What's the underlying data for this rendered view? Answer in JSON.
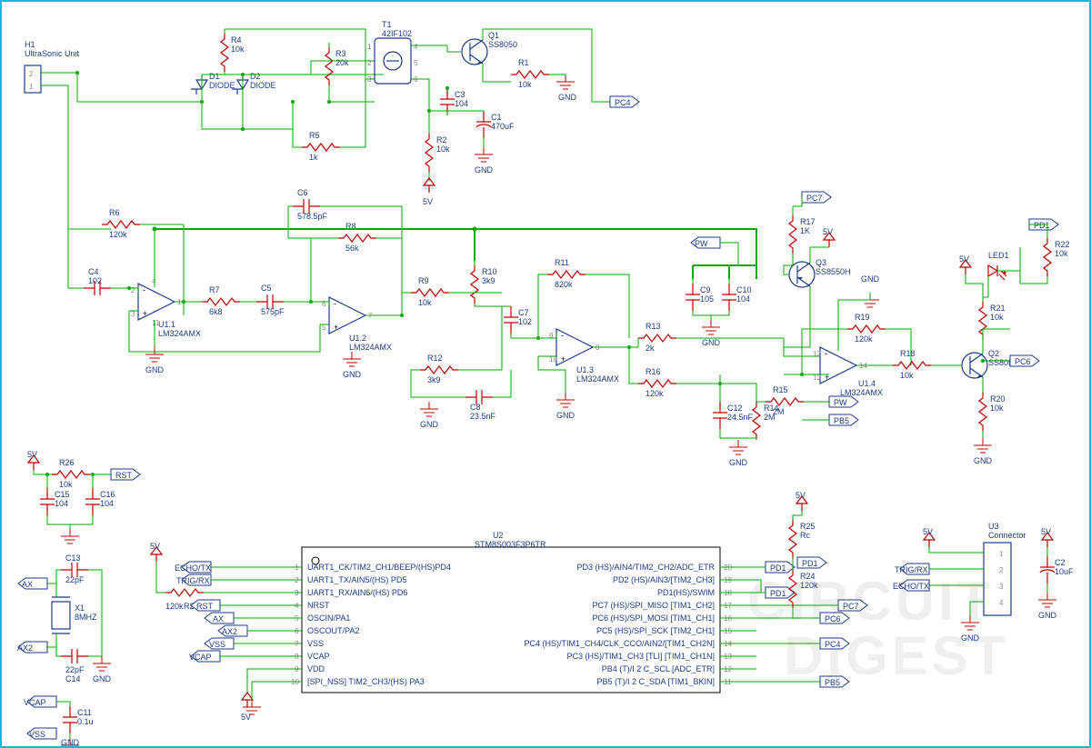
{
  "header": {
    "H1": {
      "ref": "H1",
      "name": "UltraSonic Unit"
    }
  },
  "transistors": {
    "Q1": {
      "ref": "Q1",
      "val": "SS8050"
    },
    "Q2": {
      "ref": "Q2",
      "val": "SS8050"
    },
    "Q3": {
      "ref": "Q3",
      "val": "SS8550H"
    }
  },
  "transformer": {
    "T1": {
      "ref": "T1",
      "val": "42IF102"
    }
  },
  "diodes": {
    "D1": {
      "ref": "D1",
      "val": "DIODE"
    },
    "D2": {
      "ref": "D2",
      "val": "DIODE"
    }
  },
  "led": {
    "LED1": {
      "ref": "LED1"
    }
  },
  "opamps": {
    "U1_1": {
      "ref": "U1.1",
      "val": "LM324AMX"
    },
    "U1_2": {
      "ref": "U1.2",
      "val": "LM324AMX"
    },
    "U1_3": {
      "ref": "U1.3",
      "val": "LM324AMX"
    },
    "U1_4": {
      "ref": "U1.4",
      "val": "LM324AMX"
    }
  },
  "mcu": {
    "ref": "U2",
    "val": "STM8S003F3P6TR",
    "left_pins": [
      {
        "n": "1",
        "t": "UART1_CK/TIM2_CH1/BEEP/(HS)PD4"
      },
      {
        "n": "2",
        "t": "UART1_TX/AIN5/(HS) PD5"
      },
      {
        "n": "3",
        "t": "UART1_RX/AIN6/(HS) PD6"
      },
      {
        "n": "4",
        "t": "NRST"
      },
      {
        "n": "5",
        "t": "OSCIN/PA1"
      },
      {
        "n": "6",
        "t": "OSCOUT/PA2"
      },
      {
        "n": "7",
        "t": "VSS"
      },
      {
        "n": "8",
        "t": "VCAP"
      },
      {
        "n": "9",
        "t": "VDD"
      },
      {
        "n": "10",
        "t": "[SPI_NSS] TIM2_CH3/(HS) PA3"
      }
    ],
    "right_pins": [
      {
        "n": "20",
        "t": "PD3 (HS)/AIN4/TIM2_CH2/ADC_ETR"
      },
      {
        "n": "19",
        "t": "PD2 (HS)/AIN3/[TIM2_CH3]"
      },
      {
        "n": "18",
        "t": "PD1(HS)/SWIM"
      },
      {
        "n": "17",
        "t": "PC7 (HS)/SPI_MISO [TIM1_CH2]"
      },
      {
        "n": "16",
        "t": "PC6 (HS)/SPI_MOSI [TIM1_CH1]"
      },
      {
        "n": "15",
        "t": "PC5 (HS)/SPI_SCK [TIM2_CH1]"
      },
      {
        "n": "14",
        "t": "PC4 (HS)/TIM1_CH4/CLK_CCO/AIN2/[TIM1_CH2N]"
      },
      {
        "n": "13",
        "t": "PC3 (HS)/TIM1_CH3 [TLI] [TIM1_CH1N]"
      },
      {
        "n": "12",
        "t": "PB4 (T)/I 2 C_SCL [ADC_ETR]"
      },
      {
        "n": "11",
        "t": "PB5 (T)/I 2 C_SDA [TIM1_BKIN]"
      }
    ]
  },
  "connector": {
    "U3": {
      "ref": "U3",
      "name": "Connector"
    }
  },
  "crystal": {
    "X1": {
      "ref": "X1",
      "val": "8MHZ"
    }
  },
  "resistors": {
    "R1": {
      "ref": "R1",
      "val": "10k"
    },
    "R2": {
      "ref": "R2",
      "val": "10k"
    },
    "R3": {
      "ref": "R3",
      "val": "20k"
    },
    "R4": {
      "ref": "R4",
      "val": "10k"
    },
    "R5": {
      "ref": "R5",
      "val": "1k"
    },
    "R6": {
      "ref": "R6",
      "val": "120k"
    },
    "R7": {
      "ref": "R7",
      "val": "6k8"
    },
    "R8": {
      "ref": "R8",
      "val": "56k"
    },
    "R9": {
      "ref": "R9",
      "val": "10k"
    },
    "R10": {
      "ref": "R10",
      "val": "3k9"
    },
    "R11": {
      "ref": "R11",
      "val": "820k"
    },
    "R12": {
      "ref": "R12",
      "val": "3k9"
    },
    "R13": {
      "ref": "R13",
      "val": "2k"
    },
    "R14": {
      "ref": "R14",
      "val": "2M"
    },
    "R15": {
      "ref": "R15",
      "val": "2M"
    },
    "R16": {
      "ref": "R16",
      "val": "120k"
    },
    "R17": {
      "ref": "R17",
      "val": "1K"
    },
    "R18": {
      "ref": "R18",
      "val": "10k"
    },
    "R19": {
      "ref": "R19",
      "val": "120k"
    },
    "R20": {
      "ref": "R20",
      "val": "10k"
    },
    "R21": {
      "ref": "R21",
      "val": "10k"
    },
    "R22": {
      "ref": "R22",
      "val": "10k"
    },
    "R23": {
      "ref": "R23",
      "val": "120k"
    },
    "R24": {
      "ref": "R24",
      "val": "120k"
    },
    "R25": {
      "ref": "R25",
      "val": "Rc"
    },
    "R26": {
      "ref": "R26",
      "val": "10k"
    }
  },
  "capacitors": {
    "C1": {
      "ref": "C1",
      "val": "470uF"
    },
    "C2": {
      "ref": "C2",
      "val": "10uF"
    },
    "C3": {
      "ref": "C3",
      "val": "104"
    },
    "C4": {
      "ref": "C4",
      "val": "102"
    },
    "C5": {
      "ref": "C5",
      "val": "575pF"
    },
    "C6": {
      "ref": "C6",
      "val": "578.5pF"
    },
    "C7": {
      "ref": "C7",
      "val": "102"
    },
    "C8": {
      "ref": "C8",
      "val": "23.5nF"
    },
    "C9": {
      "ref": "C9",
      "val": "105"
    },
    "C10": {
      "ref": "C10",
      "val": "104"
    },
    "C11": {
      "ref": "C11",
      "val": "0.1u"
    },
    "C12": {
      "ref": "C12",
      "val": "24.5nF"
    },
    "C13": {
      "ref": "C13",
      "val": "22pF"
    },
    "C14": {
      "ref": "C14",
      "val": "22pF"
    },
    "C15": {
      "ref": "C15",
      "val": "104"
    },
    "C16": {
      "ref": "C16",
      "val": "104"
    }
  },
  "nets": {
    "5V": "5V",
    "GND": "GND",
    "PC4": "PC4",
    "PC6": "PC6",
    "PC7": "PC7",
    "PD1": "PD1",
    "PB5": "PB5",
    "PW": "PW",
    "RST": "RST",
    "AX": "AX",
    "AX2": "AX2",
    "VCAP": "VCAP",
    "VSS": "VSS",
    "ECHO": "ECHO/TX",
    "TRIG": "TRIG/RX"
  },
  "watermark": {
    "l1": "CIRCUIT",
    "l2": "DIGEST"
  }
}
